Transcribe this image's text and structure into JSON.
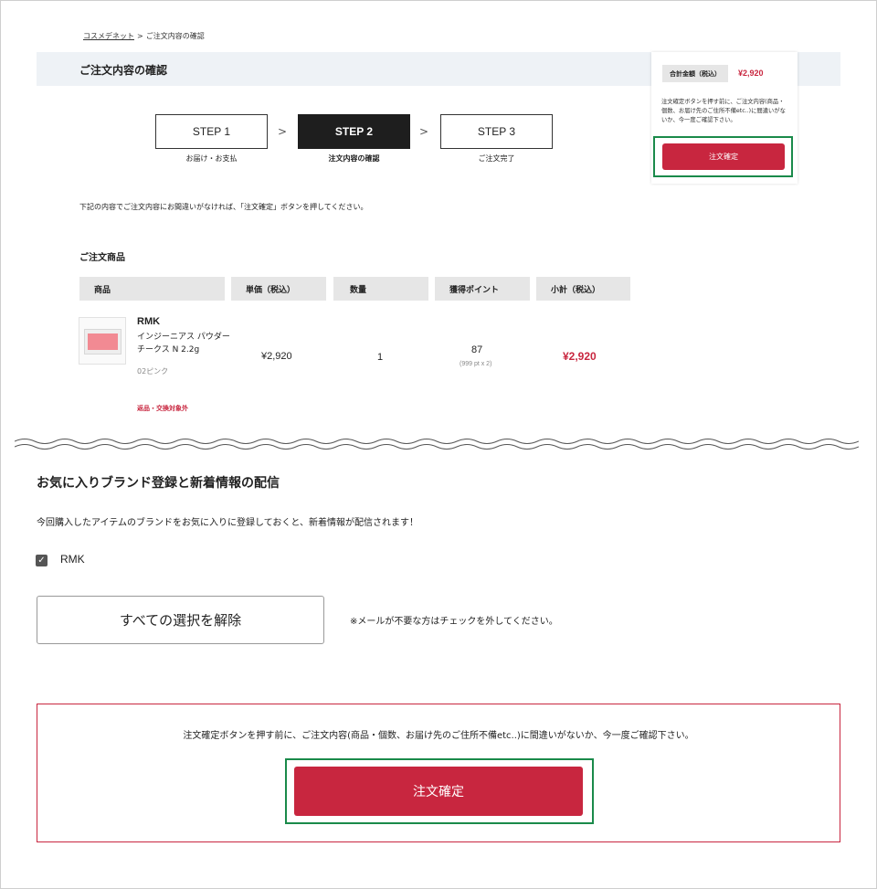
{
  "breadcrumb": {
    "home": "コスメデネット",
    "separator": ">",
    "current": "ご注文内容の確認"
  },
  "page_title": "ご注文内容の確認",
  "steps": [
    {
      "label": "STEP 1",
      "caption": "お届け・お支払"
    },
    {
      "label": "STEP 2",
      "caption": "注文内容の確認"
    },
    {
      "label": "STEP 3",
      "caption": "ご注文完了"
    }
  ],
  "step_arrow": ">",
  "instruction": "下記の内容でご注文内容にお間違いがなければ、「注文確定」ボタンを押してください。",
  "order_section_title": "ご注文商品",
  "table": {
    "headers": [
      "商品",
      "単価（税込）",
      "数量",
      "獲得ポイント",
      "小計（税込）"
    ],
    "item": {
      "brand": "RMK",
      "name": "インジーニアス パウダーチークス N 2.2g",
      "color": "02ピンク",
      "unit_price": "¥2,920",
      "quantity": "1",
      "points": "87",
      "points_detail": "(999 pt x 2)",
      "subtotal": "¥2,920",
      "return_note": "返品・交換対象外"
    }
  },
  "favorites": {
    "title": "お気に入りブランド登録と新着情報の配信",
    "description": "今回購入したアイテムのブランドをお気に入りに登録しておくと、新着情報が配信されます！",
    "brand": "RMK",
    "checked": true,
    "deselect_label": "すべての選択を解除",
    "mail_note": "※メールが不要な方はチェックを外してください。"
  },
  "confirm": {
    "note": "注文確定ボタンを押す前に、ご注文内容(商品・個数、お届け先のご住所不備etc..)に間違いがないか、今一度ご確認下さい。",
    "button_label": "注文確定"
  },
  "side_panel": {
    "total_label": "合計金額（税込）",
    "total_value": "¥2,920",
    "note": "注文確定ボタンを押す前に、ご注文内容(商品・個数、お届け先のご住所不備etc..)に間違いがないか、今一度ご確認下さい。",
    "button_label": "注文確定"
  },
  "colors": {
    "accent": "#c8263f",
    "highlight": "#1a8a4a",
    "active_step": "#1e1e1e",
    "band": "#eef2f6"
  }
}
